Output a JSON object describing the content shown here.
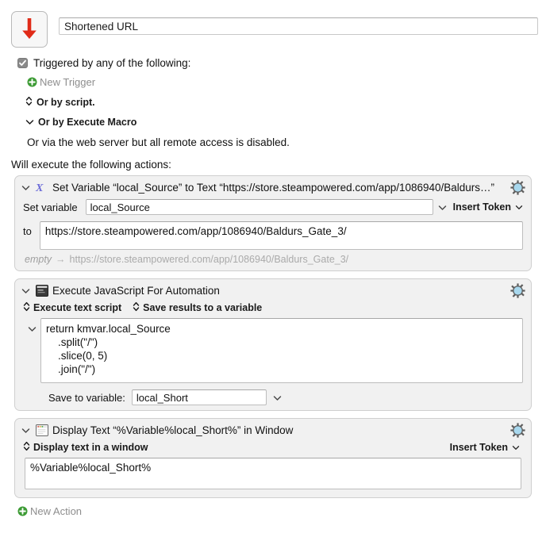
{
  "macro": {
    "icon": "red-down-arrow-icon",
    "title_value": "Shortened URL",
    "title_placeholder": "Macro Name"
  },
  "triggers": {
    "checkbox_checked": true,
    "checkbox_label": "Triggered by any of the following:",
    "new_trigger_label": "New Trigger",
    "or_by_script": "Or by script.",
    "or_by_execute_macro": "Or by Execute Macro",
    "web_server_note": "Or via the web server but all remote access is disabled."
  },
  "actions_header": "Will execute the following actions:",
  "actions": [
    {
      "icon": "script-x-icon",
      "title": "Set Variable “local_Source” to Text “https://store.steampowered.com/app/1086940/Baldurs…”",
      "set_variable_label": "Set variable",
      "variable_value": "local_Source",
      "insert_token_label": "Insert Token",
      "to_label": "to",
      "text_value": "https://store.steampowered.com/app/1086940/Baldurs_Gate_3/",
      "result_before": "empty",
      "result_arrow": "→",
      "result_after": "https://store.steampowered.com/app/1086940/Baldurs_Gate_3/",
      "gear": "gear-icon"
    },
    {
      "icon": "terminal-script-icon",
      "title": "Execute JavaScript For Automation",
      "popup_source": "Execute text script",
      "popup_destination": "Save results to a variable",
      "script_lines": [
        "return kmvar.local_Source",
        "    .split(\"/\")",
        "    .slice(0, 5)",
        "    .join(\"/\")"
      ],
      "save_label": "Save to variable:",
      "save_value": "local_Short",
      "gear": "gear-icon"
    },
    {
      "icon": "window-icon",
      "title": "Display Text “%Variable%local_Short%” in Window",
      "popup_style": "Display text in a window",
      "insert_token_label": "Insert Token",
      "text_value": "%Variable%local_Short%",
      "gear": "gear-icon"
    }
  ],
  "new_action_label": "New Action",
  "colors": {
    "macro_arrow": "#e02b18",
    "script_x": "#6c6cd8",
    "gear": "#a8d8ee",
    "green_plus": "#3d9b35",
    "panel_bg": "#f1f1f1",
    "page_bg": "#ffffff"
  }
}
